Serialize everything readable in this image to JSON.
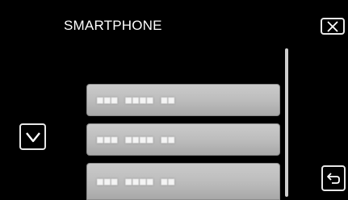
{
  "header": {
    "title": "SMARTPHONE"
  },
  "controls": {
    "close_icon": "close-x-icon",
    "scroll_down_icon": "chevron-down-icon",
    "back_icon": "return-arrow-icon"
  },
  "device_list": {
    "items": [
      {
        "label": "■■■ ■■■■ ■■"
      },
      {
        "label": "■■■ ■■■■ ■■"
      },
      {
        "label": "■■■ ■■■■ ■■"
      }
    ]
  },
  "colors": {
    "background": "#000000",
    "text": "#ffffff",
    "button_border": "#e8e8e8",
    "list_item_fill": "#bdbdbd",
    "scrollbar": "#cfcfcf"
  }
}
